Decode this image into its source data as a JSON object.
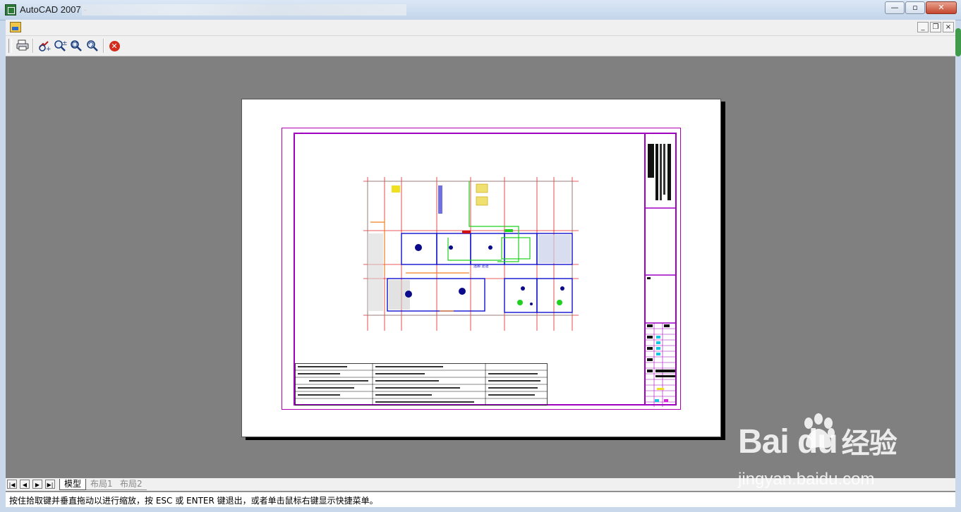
{
  "window": {
    "title": "AutoCAD 2007 -",
    "minimize_glyph": "—",
    "maximize_glyph": "▫",
    "close_glyph": "✕"
  },
  "document": {
    "minimize_glyph": "_",
    "restore_glyph": "❐",
    "close_glyph": "×"
  },
  "toolbar": {
    "items": [
      {
        "name": "plot-icon",
        "glyph": "🖶"
      },
      {
        "name": "realtime-zoom-pan-icon",
        "glyph": "✥"
      },
      {
        "name": "zoom-realtime-icon",
        "glyph": "🔍"
      },
      {
        "name": "zoom-window-icon",
        "glyph": "⊕"
      },
      {
        "name": "zoom-previous-icon",
        "glyph": "⟲"
      },
      {
        "name": "close-preview-icon",
        "glyph": "✕"
      }
    ]
  },
  "tabs": {
    "nav": [
      "|◀",
      "◀",
      "▶",
      "▶|"
    ],
    "items": [
      "模型",
      "布局1",
      "布局2"
    ],
    "active": "模型"
  },
  "command_line": {
    "text": "按住拾取键并垂直拖动以进行缩放，按 ESC 或 ENTER 键退出，或者单击鼠标右键显示快捷菜单。"
  },
  "watermark": {
    "brand_text": "Bai  du",
    "secondary_text": "经验",
    "url_text": "jingyan.baidu.com"
  },
  "colors": {
    "canvas_bg": "#808080",
    "sheet_border": "#a000c0",
    "grid_lines": "#e02020",
    "walls": "#1010d0"
  }
}
